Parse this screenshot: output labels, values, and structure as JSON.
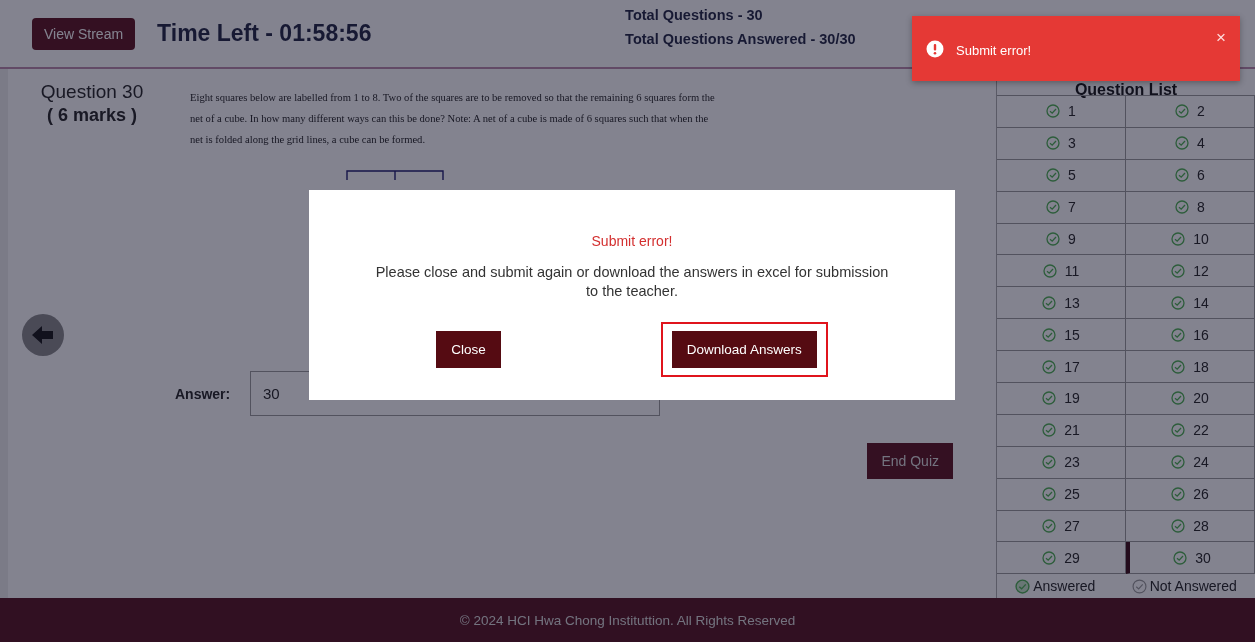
{
  "header": {
    "view_stream": "View Stream",
    "time_left": "Time Left - 01:58:56",
    "total_questions": "Total Questions - 30",
    "total_answered": "Total Questions Answered - 30/30"
  },
  "question": {
    "title": "Question 30",
    "marks": "( 6 marks )",
    "text": "Eight squares below are labelled from 1 to 8. Two of the squares are to be removed so that the remaining 6 squares form the net of a cube. In how many different ways can this be done? Note: A net of a cube is made of 6 squares such that when the net is folded along the grid lines, a cube can be formed."
  },
  "answer": {
    "label": "Answer:",
    "value": "30"
  },
  "end_quiz": "End Quiz",
  "question_list": {
    "title": "Question List",
    "items": [
      {
        "number": "1",
        "answered": true,
        "selected": false
      },
      {
        "number": "2",
        "answered": true,
        "selected": false
      },
      {
        "number": "3",
        "answered": true,
        "selected": false
      },
      {
        "number": "4",
        "answered": true,
        "selected": false
      },
      {
        "number": "5",
        "answered": true,
        "selected": false
      },
      {
        "number": "6",
        "answered": true,
        "selected": false
      },
      {
        "number": "7",
        "answered": true,
        "selected": false
      },
      {
        "number": "8",
        "answered": true,
        "selected": false
      },
      {
        "number": "9",
        "answered": true,
        "selected": false
      },
      {
        "number": "10",
        "answered": true,
        "selected": false
      },
      {
        "number": "11",
        "answered": true,
        "selected": false
      },
      {
        "number": "12",
        "answered": true,
        "selected": false
      },
      {
        "number": "13",
        "answered": true,
        "selected": false
      },
      {
        "number": "14",
        "answered": true,
        "selected": false
      },
      {
        "number": "15",
        "answered": true,
        "selected": false
      },
      {
        "number": "16",
        "answered": true,
        "selected": false
      },
      {
        "number": "17",
        "answered": true,
        "selected": false
      },
      {
        "number": "18",
        "answered": true,
        "selected": false
      },
      {
        "number": "19",
        "answered": true,
        "selected": false
      },
      {
        "number": "20",
        "answered": true,
        "selected": false
      },
      {
        "number": "21",
        "answered": true,
        "selected": false
      },
      {
        "number": "22",
        "answered": true,
        "selected": false
      },
      {
        "number": "23",
        "answered": true,
        "selected": false
      },
      {
        "number": "24",
        "answered": true,
        "selected": false
      },
      {
        "number": "25",
        "answered": true,
        "selected": false
      },
      {
        "number": "26",
        "answered": true,
        "selected": false
      },
      {
        "number": "27",
        "answered": true,
        "selected": false
      },
      {
        "number": "28",
        "answered": true,
        "selected": false
      },
      {
        "number": "29",
        "answered": true,
        "selected": false
      },
      {
        "number": "30",
        "answered": true,
        "selected": true
      }
    ],
    "legend": [
      {
        "label": "Answered",
        "kind": "answered"
      },
      {
        "label": "Not Answered",
        "kind": "not_answered"
      }
    ]
  },
  "footer": "© 2024 HCI Hwa Chong Instituttion. All Rights Reserved",
  "toast": {
    "message": "Submit error!",
    "close": "×"
  },
  "dialog": {
    "title": "Submit error!",
    "message": "Please close and submit again or download the answers in excel for submission to the teacher.",
    "buttons": [
      {
        "label": "Close",
        "highlighted": false
      },
      {
        "label": "Download Answers",
        "highlighted": true
      }
    ]
  }
}
